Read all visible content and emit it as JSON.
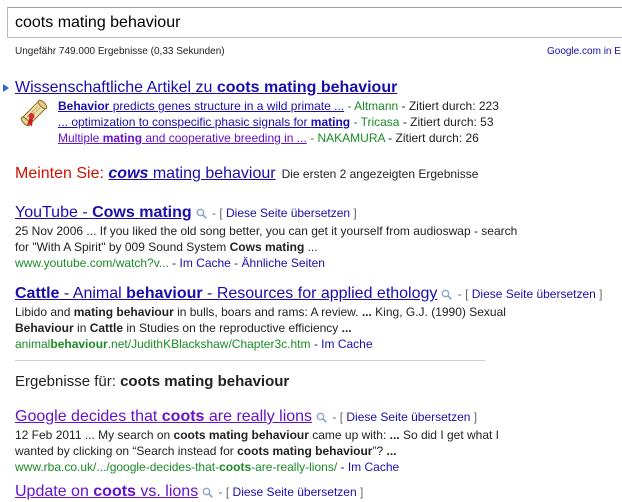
{
  "search": {
    "query": "coots mating behaviour"
  },
  "stats": {
    "text": "Ungefähr 749.000 Ergebnisse (0,33 Sekunden)",
    "google_com_link": "Google.com in E"
  },
  "scholar": {
    "title_prefix": "Wissenschaftliche Artikel zu ",
    "title_query": "coots mating behaviour",
    "items": [
      {
        "title_bold": "Behavior",
        "title_rest": " predicts genes structure in a wild primate ...",
        "author": " - Altmann",
        "cited": " - Zitiert durch: 223"
      },
      {
        "title_pre": "... optimization to conspecific phasic signals for ",
        "title_bold": "mating",
        "author": " - Tricasa",
        "cited": " - Zitiert durch: 53"
      },
      {
        "title_pre": "Multiple ",
        "title_bold": "mating",
        "title_rest": " and cooperative breeding in ...",
        "author": " - NAKAMURA",
        "cited": " - Zitiert durch: 26"
      }
    ]
  },
  "did_you_mean": {
    "label": "Meinten Sie: ",
    "corrected": "cows",
    "rest": " mating behaviour",
    "note": "Die ersten 2 angezeigten Ergebnisse"
  },
  "translate": {
    "open": " - [ ",
    "label": "Diese Seite übersetzen",
    "close": " ]"
  },
  "results": [
    {
      "title": [
        {
          "t": "YouTube - "
        },
        {
          "t": "Cows mating",
          "b": true
        }
      ],
      "date": "25 Nov 2006",
      "snippet_l1": [
        {
          "t": " ... If you liked the old song better, you can get it yourself from audioswap - search"
        }
      ],
      "snippet_l2": [
        {
          "t": "for \"With A Spirit\" by 009 Sound System "
        },
        {
          "t": "Cows mating",
          "b": true
        },
        {
          "t": " ..."
        }
      ],
      "url": [
        {
          "t": "www.youtube.com/watch?v..."
        }
      ],
      "cache": " - Im Cache - ",
      "similar": "Ähnliche Seiten"
    },
    {
      "title": [
        {
          "t": "Cattle",
          "b": true
        },
        {
          "t": " - Animal "
        },
        {
          "t": "behaviour",
          "b": true
        },
        {
          "t": " - Resources for applied ethology"
        }
      ],
      "snippet_l1": [
        {
          "t": "Libido and "
        },
        {
          "t": "mating behaviour",
          "b": true
        },
        {
          "t": " in bulls, boars and rams: A review. "
        },
        {
          "t": "...",
          "b": true
        },
        {
          "t": " King, G.J. (1990) Sexual"
        }
      ],
      "snippet_l2": [
        {
          "t": "Behaviour",
          "b": true
        },
        {
          "t": " in "
        },
        {
          "t": "Cattle",
          "b": true
        },
        {
          "t": " in Studies on the reproductive efficiency "
        },
        {
          "t": "...",
          "b": true
        }
      ],
      "url": [
        {
          "t": "animal"
        },
        {
          "t": "behaviour",
          "b": true
        },
        {
          "t": ".net/JudithKBlackshaw/Chapter3c.htm"
        }
      ],
      "cache": " - Im Cache"
    },
    {
      "title": [
        {
          "t": "Google decides that "
        },
        {
          "t": "coots",
          "b": true
        },
        {
          "t": " are really lions"
        }
      ],
      "date": "12 Feb 2011",
      "snippet_l1": [
        {
          "t": " ... My search on "
        },
        {
          "t": "coots mating behaviour",
          "b": true
        },
        {
          "t": " came up with: "
        },
        {
          "t": "...",
          "b": true
        },
        {
          "t": " So did I get what I"
        }
      ],
      "snippet_l2": [
        {
          "t": "wanted by clicking on “Search instead for "
        },
        {
          "t": "coots mating behaviour",
          "b": true
        },
        {
          "t": "”? "
        },
        {
          "t": "...",
          "b": true
        }
      ],
      "url": [
        {
          "t": "www.rba.co.uk/.../google-decides-that-"
        },
        {
          "t": "coots",
          "b": true
        },
        {
          "t": "-are-really-lions/"
        }
      ],
      "cache": " - Im Cache"
    },
    {
      "title": [
        {
          "t": "Update on "
        },
        {
          "t": "coots",
          "b": true
        },
        {
          "t": " vs. lions"
        }
      ]
    }
  ],
  "results_for": {
    "label": "Ergebnisse für: ",
    "query": "coots mating behaviour"
  },
  "colors": {
    "link": "#1a0dab",
    "visited": "#6611cc",
    "url_green": "#1a8a25",
    "did_you_mean_red": "#cc1100"
  },
  "icons": {
    "scholar": "scroll-diploma-icon",
    "preview": "magnifier-icon"
  }
}
